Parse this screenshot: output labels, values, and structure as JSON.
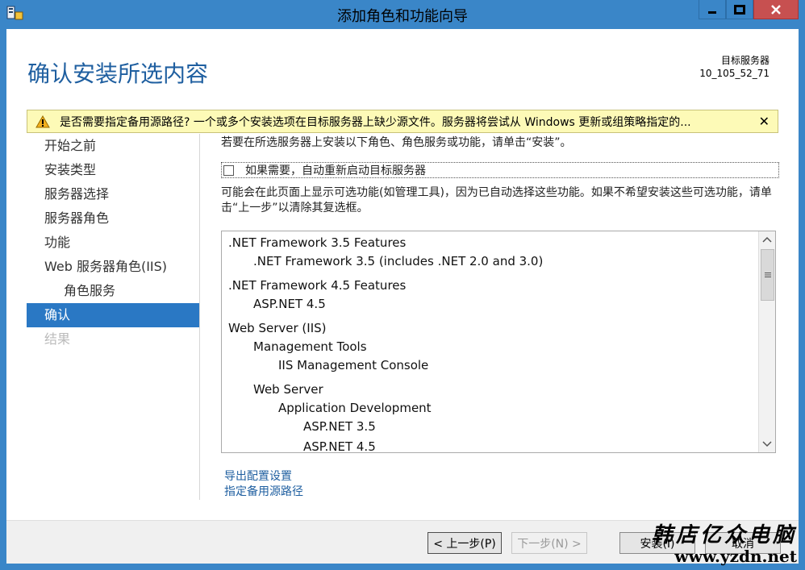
{
  "window": {
    "title": "添加角色和功能向导"
  },
  "header": {
    "page_title": "确认安装所选内容",
    "target_server_label": "目标服务器",
    "target_server_name": "10_105_52_71"
  },
  "warning": {
    "text": "是否需要指定备用源路径? 一个或多个安装选项在目标服务器上缺少源文件。服务器将尝试从 Windows 更新或组策略指定的...",
    "close": "✕"
  },
  "nav": {
    "items": [
      {
        "label": "开始之前"
      },
      {
        "label": "安装类型"
      },
      {
        "label": "服务器选择"
      },
      {
        "label": "服务器角色"
      },
      {
        "label": "功能"
      },
      {
        "label": "Web 服务器角色(IIS)"
      },
      {
        "label": "角色服务"
      },
      {
        "label": "确认"
      },
      {
        "label": "结果"
      }
    ]
  },
  "content": {
    "intro": "若要在所选服务器上安装以下角色、角色服务或功能，请单击“安装”。",
    "restart_checkbox_label": "如果需要，自动重新启动目标服务器",
    "optional_text": "可能会在此页面上显示可选功能(如管理工具)，因为已自动选择这些功能。如果不希望安装这些可选功能，请单击“上一步”以清除其复选框。",
    "features": [
      {
        "label": ".NET Framework 3.5 Features"
      },
      {
        "label": ".NET Framework 3.5 (includes .NET 2.0 and 3.0)"
      },
      {
        "label": ".NET Framework 4.5 Features"
      },
      {
        "label": "ASP.NET 4.5"
      },
      {
        "label": "Web Server (IIS)"
      },
      {
        "label": "Management Tools"
      },
      {
        "label": "IIS Management Console"
      },
      {
        "label": "Web Server"
      },
      {
        "label": "Application Development"
      },
      {
        "label": "ASP.NET 3.5"
      },
      {
        "label": "ASP.NET 4.5"
      }
    ],
    "export_link": "导出配置设置",
    "alt_source_link": "指定备用源路径"
  },
  "footer": {
    "prev_label": "< 上一步(P)",
    "next_label": "下一步(N) >",
    "install_label": "安装(I)",
    "cancel_label": "取消"
  },
  "watermark": {
    "cn": "韩店亿众电脑",
    "url": "www.yzdn.net"
  },
  "colors": {
    "title_bar": "#3a86c8",
    "accent": "#1f5fa0",
    "nav_active": "#2a78c4",
    "warning_bg": "#fdfab7",
    "close_button": "#c75050"
  }
}
